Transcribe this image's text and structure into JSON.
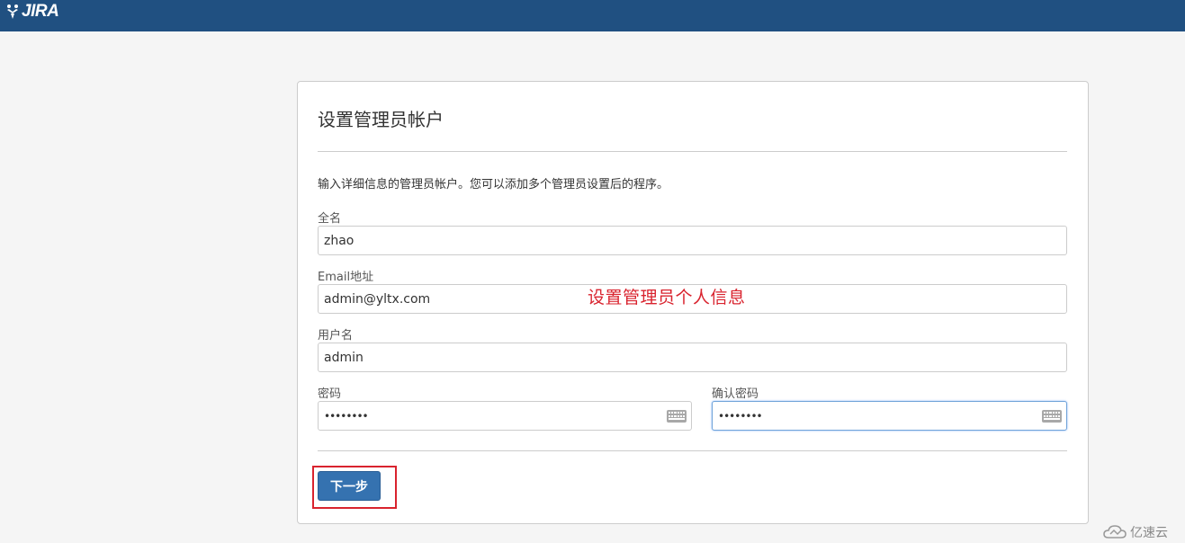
{
  "header": {
    "logo_text": "JIRA"
  },
  "form": {
    "title": "设置管理员帐户",
    "description": "输入详细信息的管理员帐户。您可以添加多个管理员设置后的程序。",
    "fullname": {
      "label": "全名",
      "value": "zhao"
    },
    "email": {
      "label": "Email地址",
      "value": "admin@yltx.com"
    },
    "username": {
      "label": "用户名",
      "value": "admin"
    },
    "password": {
      "label": "密码",
      "value": "••••••••"
    },
    "confirm_password": {
      "label": "确认密码",
      "value": "••••••••"
    },
    "next_button": "下一步"
  },
  "annotation": {
    "text": "设置管理员个人信息",
    "color": "#d9232e"
  },
  "watermark": {
    "text": "亿速云"
  },
  "colors": {
    "header_bg": "#205081",
    "button_bg": "#3572b0",
    "highlight": "#d9232e"
  }
}
